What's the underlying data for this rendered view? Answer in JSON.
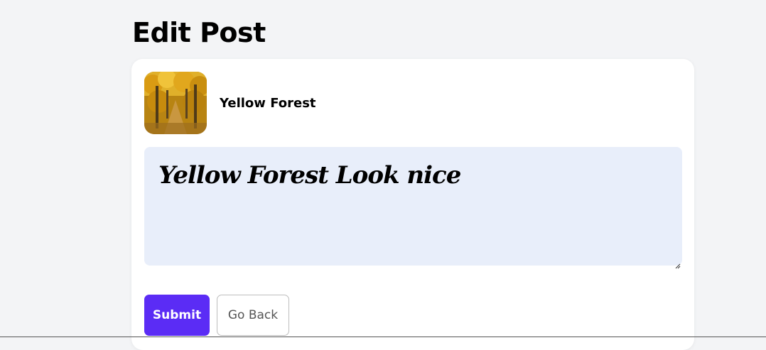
{
  "page": {
    "title": "Edit Post"
  },
  "post": {
    "name": "Yellow Forest",
    "thumbnail": "yellow-forest-image"
  },
  "caption": {
    "value": "Yellow Forest Look nice"
  },
  "actions": {
    "submit_label": "Submit",
    "back_label": "Go Back"
  },
  "colors": {
    "background": "#f3f4f6",
    "card": "#ffffff",
    "textarea": "#e8eefa",
    "submit": "#5b2cf5",
    "back_border": "#bdbdbd"
  }
}
